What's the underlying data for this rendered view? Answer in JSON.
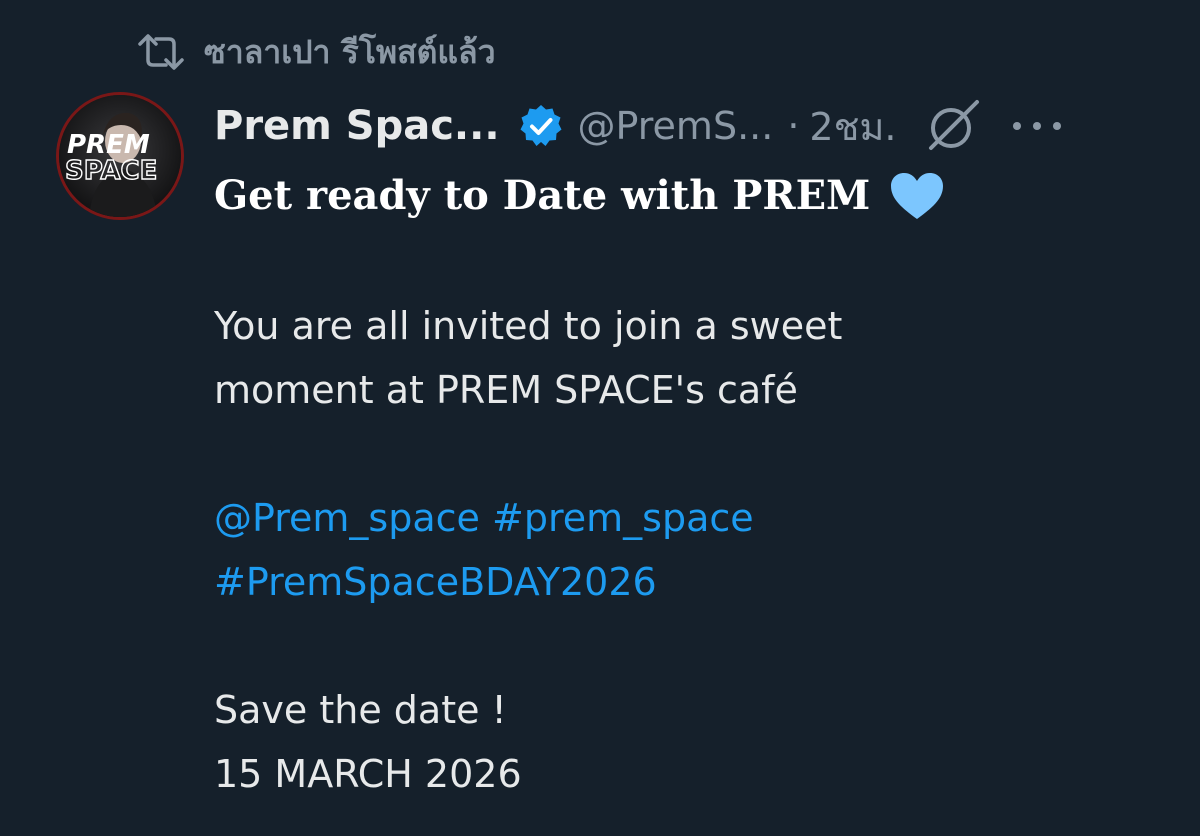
{
  "repost": {
    "icon": "repost-icon",
    "label": "ซาลาเปา รีโพสต์แล้ว"
  },
  "tweet": {
    "avatar": {
      "icon": "avatar-image",
      "text_line1": "PREM",
      "text_line2": "SPACE"
    },
    "author_name": "Prem Spac...",
    "verified_icon": "verified-badge-icon",
    "handle": "@PremS...",
    "separator": "·",
    "timestamp": "2ชม.",
    "grok_icon": "grok-icon",
    "more_icon": "more-options-icon",
    "headline": "Get ready to Date with PREM",
    "heart_icon": "light-blue-heart-icon",
    "body_line1": "You are all invited to join a sweet",
    "body_line2": "moment at PREM SPACE's café",
    "mention": "@Prem_space",
    "hashtag1": "#prem_space",
    "hashtag2": "#PremSpaceBDAY2026",
    "save_line": "Save the date !",
    "date_line": "15 MARCH 2026"
  },
  "colors": {
    "background": "#15202b",
    "text_primary": "#e7e9ea",
    "text_secondary": "#8b98a5",
    "link": "#1d9bf0",
    "verified": "#1d9bf0",
    "heart": "#7cc6fe",
    "avatar_ring": "#7a1717"
  }
}
